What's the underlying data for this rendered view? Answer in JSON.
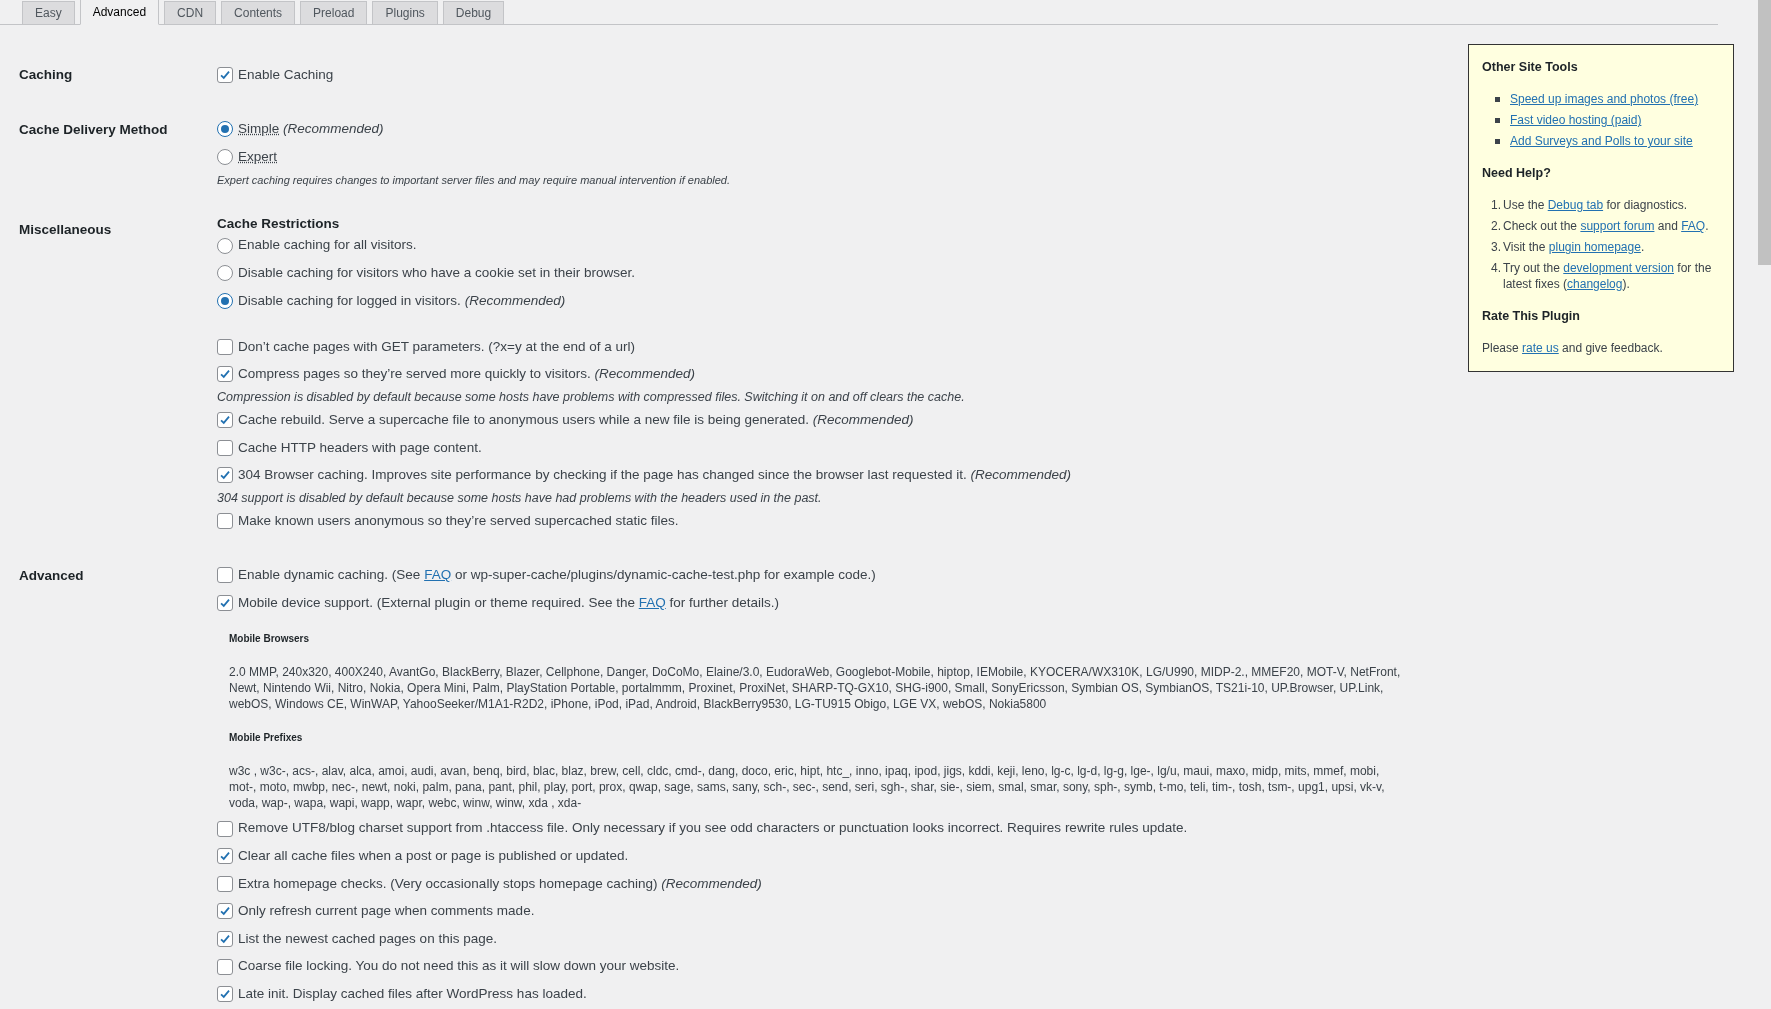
{
  "tabs": [
    {
      "label": "Easy",
      "selected": false
    },
    {
      "label": "Advanced",
      "selected": true
    },
    {
      "label": "CDN",
      "selected": false
    },
    {
      "label": "Contents",
      "selected": false
    },
    {
      "label": "Preload",
      "selected": false
    },
    {
      "label": "Plugins",
      "selected": false
    },
    {
      "label": "Debug",
      "selected": false
    }
  ],
  "sections": [
    {
      "label": "Caching",
      "items": [
        {
          "kind": "checkbox",
          "checked": true,
          "parts": [
            {
              "kind": "text",
              "text": "Enable Caching"
            }
          ]
        }
      ]
    },
    {
      "label": "Cache Delivery Method",
      "items": [
        {
          "kind": "radio",
          "selected": true,
          "parts": [
            {
              "kind": "dotted",
              "text": "Simple"
            },
            {
              "kind": "italic",
              "text": "(Recommended)"
            }
          ]
        },
        {
          "kind": "radio",
          "selected": false,
          "parts": [
            {
              "kind": "dotted",
              "text": "Expert"
            }
          ]
        },
        {
          "kind": "description",
          "text": "Expert caching requires changes to important server files and may require manual intervention if enabled."
        }
      ]
    },
    {
      "label": "Miscellaneous",
      "items": [
        {
          "kind": "heading",
          "text": "Cache Restrictions"
        },
        {
          "kind": "radio",
          "selected": false,
          "parts": [
            {
              "kind": "text",
              "text": "Enable caching for all visitors."
            }
          ]
        },
        {
          "kind": "radio",
          "selected": false,
          "parts": [
            {
              "kind": "text",
              "text": "Disable caching for visitors who have a cookie set in their browser."
            }
          ]
        },
        {
          "kind": "radio",
          "selected": true,
          "parts": [
            {
              "kind": "text",
              "text": "Disable caching for logged in visitors."
            },
            {
              "kind": "italic",
              "text": "(Recommended)"
            }
          ]
        },
        {
          "kind": "checkbox",
          "checked": false,
          "spaced": true,
          "parts": [
            {
              "kind": "text",
              "text": "Don’t cache pages with GET parameters. (?x=y at the end of a url)"
            }
          ]
        },
        {
          "kind": "checkbox",
          "checked": true,
          "parts": [
            {
              "kind": "text",
              "text": "Compress pages so they’re served more quickly to visitors."
            },
            {
              "kind": "italic",
              "text": "(Recommended)"
            }
          ]
        },
        {
          "kind": "note",
          "text": "Compression is disabled by default because some hosts have problems with compressed files. Switching it on and off clears the cache."
        },
        {
          "kind": "checkbox",
          "checked": true,
          "parts": [
            {
              "kind": "text",
              "text": "Cache rebuild. Serve a supercache file to anonymous users while a new file is being generated."
            },
            {
              "kind": "italic",
              "text": "(Recommended)"
            }
          ]
        },
        {
          "kind": "checkbox",
          "checked": false,
          "parts": [
            {
              "kind": "text",
              "text": "Cache HTTP headers with page content."
            }
          ]
        },
        {
          "kind": "checkbox",
          "checked": true,
          "parts": [
            {
              "kind": "text",
              "text": "304 Browser caching. Improves site performance by checking if the page has changed since the browser last requested it."
            },
            {
              "kind": "italic",
              "text": "(Recommended)"
            }
          ]
        },
        {
          "kind": "note",
          "text": "304 support is disabled by default because some hosts have had problems with the headers used in the past."
        },
        {
          "kind": "checkbox",
          "checked": false,
          "parts": [
            {
              "kind": "text",
              "text": "Make known users anonymous so they’re served supercached static files."
            }
          ]
        }
      ]
    },
    {
      "label": "Advanced",
      "items": [
        {
          "kind": "checkbox",
          "checked": false,
          "parts": [
            {
              "kind": "text",
              "text": "Enable dynamic caching. (See"
            },
            {
              "kind": "link",
              "text": "FAQ"
            },
            {
              "kind": "text",
              "text": "or wp-super-cache/plugins/dynamic-cache-test.php for example code.)"
            }
          ]
        },
        {
          "kind": "checkbox",
          "checked": true,
          "parts": [
            {
              "kind": "text",
              "text": "Mobile device support. (External plugin or theme required. See the"
            },
            {
              "kind": "link",
              "text": "FAQ"
            },
            {
              "kind": "text",
              "text": "for further details.)"
            }
          ]
        },
        {
          "kind": "subheading",
          "text": "Mobile Browsers"
        },
        {
          "kind": "paragraph",
          "text": "2.0 MMP, 240x320, 400X240, AvantGo, BlackBerry, Blazer, Cellphone, Danger, DoCoMo, Elaine/3.0, EudoraWeb, Googlebot-Mobile, hiptop, IEMobile, KYOCERA/WX310K, LG/U990, MIDP-2., MMEF20, MOT-V, NetFront, Newt, Nintendo Wii, Nitro, Nokia, Opera Mini, Palm, PlayStation Portable, portalmmm, Proxinet, ProxiNet, SHARP-TQ-GX10, SHG-i900, Small, SonyEricsson, Symbian OS, SymbianOS, TS21i-10, UP.Browser, UP.Link, webOS, Windows CE, WinWAP, YahooSeeker/M1A1-R2D2, iPhone, iPod, iPad, Android, BlackBerry9530, LG-TU915 Obigo, LGE VX, webOS, Nokia5800"
        },
        {
          "kind": "subheading",
          "text": "Mobile Prefixes"
        },
        {
          "kind": "paragraph",
          "text": "w3c , w3c-, acs-, alav, alca, amoi, audi, avan, benq, bird, blac, blaz, brew, cell, cldc, cmd-, dang, doco, eric, hipt, htc_, inno, ipaq, ipod, jigs, kddi, keji, leno, lg-c, lg-d, lg-g, lge-, lg/u, maui, maxo, midp, mits, mmef, mobi, mot-, moto, mwbp, nec-, newt, noki, palm, pana, pant, phil, play, port, prox, qwap, sage, sams, sany, sch-, sec-, send, seri, sgh-, shar, sie-, siem, smal, smar, sony, sph-, symb, t-mo, teli, tim-, tosh, tsm-, upg1, upsi, vk-v, voda, wap-, wapa, wapi, wapp, wapr, webc, winw, winw, xda , xda-"
        },
        {
          "kind": "checkbox",
          "checked": false,
          "parts": [
            {
              "kind": "text",
              "text": "Remove UTF8/blog charset support from .htaccess file. Only necessary if you see odd characters or punctuation looks incorrect. Requires rewrite rules update."
            }
          ]
        },
        {
          "kind": "checkbox",
          "checked": true,
          "parts": [
            {
              "kind": "text",
              "text": "Clear all cache files when a post or page is published or updated."
            }
          ]
        },
        {
          "kind": "checkbox",
          "checked": false,
          "parts": [
            {
              "kind": "text",
              "text": "Extra homepage checks. (Very occasionally stops homepage caching)"
            },
            {
              "kind": "italic",
              "text": "(Recommended)"
            }
          ]
        },
        {
          "kind": "checkbox",
          "checked": true,
          "parts": [
            {
              "kind": "text",
              "text": "Only refresh current page when comments made."
            }
          ]
        },
        {
          "kind": "checkbox",
          "checked": true,
          "parts": [
            {
              "kind": "text",
              "text": "List the newest cached pages on this page."
            }
          ]
        },
        {
          "kind": "checkbox",
          "checked": false,
          "parts": [
            {
              "kind": "text",
              "text": "Coarse file locking. You do not need this as it will slow down your website."
            }
          ]
        },
        {
          "kind": "checkbox",
          "checked": true,
          "parts": [
            {
              "kind": "text",
              "text": "Late init. Display cached files after WordPress has loaded."
            }
          ]
        }
      ]
    }
  ],
  "sidebar": {
    "groups": [
      {
        "heading": "Other Site Tools",
        "kind": "bullet",
        "items": [
          {
            "parts": [
              {
                "kind": "link",
                "text": "Speed up images and photos (free)"
              }
            ]
          },
          {
            "parts": [
              {
                "kind": "link",
                "text": "Fast video hosting (paid)"
              }
            ]
          },
          {
            "parts": [
              {
                "kind": "link",
                "text": "Add Surveys and Polls to your site"
              }
            ]
          }
        ]
      },
      {
        "heading": "Need Help?",
        "kind": "ordered",
        "items": [
          {
            "number": "1.",
            "parts": [
              {
                "kind": "text",
                "text": "Use the"
              },
              {
                "kind": "link",
                "text": "Debug tab"
              },
              {
                "kind": "text",
                "text": "for diagnostics."
              }
            ]
          },
          {
            "number": "2.",
            "parts": [
              {
                "kind": "text",
                "text": "Check out the"
              },
              {
                "kind": "link",
                "text": "support forum"
              },
              {
                "kind": "text",
                "text": "and"
              },
              {
                "kind": "link",
                "text": "FAQ"
              },
              {
                "kind": "tail",
                "text": "."
              }
            ]
          },
          {
            "number": "3.",
            "parts": [
              {
                "kind": "text",
                "text": "Visit the"
              },
              {
                "kind": "link",
                "text": "plugin homepage"
              },
              {
                "kind": "tail",
                "text": "."
              }
            ]
          },
          {
            "number": "4.",
            "parts": [
              {
                "kind": "text",
                "text": "Try out the"
              },
              {
                "kind": "link",
                "text": "development version"
              },
              {
                "kind": "text",
                "text": "for the latest fixes ("
              },
              {
                "kind": "link",
                "text": "changelog"
              },
              {
                "kind": "tail",
                "text": ")."
              }
            ]
          }
        ]
      },
      {
        "heading": "Rate This Plugin",
        "kind": "paragraph",
        "items": [
          {
            "parts": [
              {
                "kind": "text",
                "text": "Please"
              },
              {
                "kind": "link",
                "text": "rate us"
              },
              {
                "kind": "text",
                "text": "and give feedback."
              }
            ]
          }
        ]
      }
    ]
  }
}
